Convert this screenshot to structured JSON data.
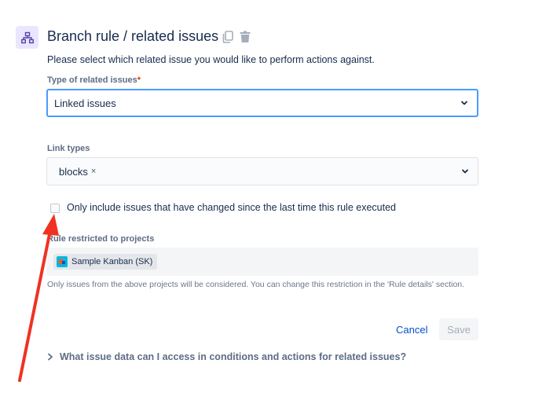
{
  "header": {
    "title": "Branch rule / related issues",
    "icons": [
      "branch-icon",
      "copy-icon",
      "trash-icon"
    ]
  },
  "description": "Please select which related issue you would like to perform actions against.",
  "related_type": {
    "label": "Type of related issues",
    "required_marker": "*",
    "value": "Linked issues"
  },
  "link_types": {
    "label": "Link types",
    "chips": [
      {
        "label": "blocks",
        "remove": "×"
      }
    ]
  },
  "only_changed": {
    "label": "Only include issues that have changed since the last time this rule executed",
    "checked": false
  },
  "restricted": {
    "label": "Rule restricted to projects",
    "project": "Sample Kanban (SK)",
    "help": "Only issues from the above projects will be considered. You can change this restriction in the 'Rule details' section."
  },
  "actions": {
    "cancel": "Cancel",
    "save": "Save"
  },
  "expander": {
    "label": "What issue data can I access in conditions and actions for related issues?"
  },
  "colors": {
    "annotation_arrow": "#ef3222",
    "primary": "#0052cc",
    "focus_border": "#4c9aff",
    "icon_bg": "#eae6ff"
  }
}
